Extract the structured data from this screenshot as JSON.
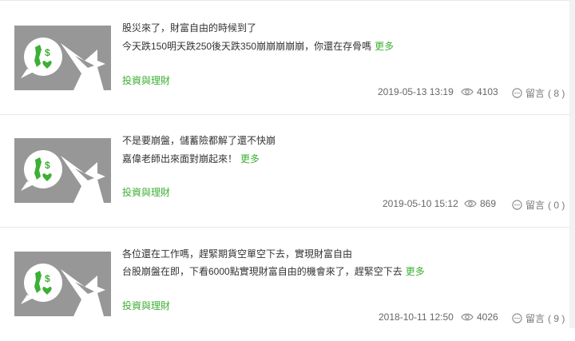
{
  "posts": [
    {
      "title": "股災來了，財富自由的時候到了",
      "excerpt": "今天跌150明天跌250後天跌350崩崩崩崩崩，你還在存骨嗎",
      "more_label": "更多",
      "category": "投資與理財",
      "date": "2019-05-13 13:19",
      "views": "4103",
      "comments_label": "留言",
      "comments_count": "( 8 )"
    },
    {
      "title": "不是要崩盤，儲蓄險都解了還不快崩",
      "excerpt": "嘉偉老師出來面對崩起來！",
      "more_label": "更多",
      "category": "投資與理財",
      "date": "2019-05-10 15:12",
      "views": "869",
      "comments_label": "留言",
      "comments_count": "( 0 )"
    },
    {
      "title": "各位還在工作嗎，趕緊期貨空單空下去，實現財富自由",
      "excerpt": "台股崩盤在即，下看6000點實現財富自由的機會來了，趕緊空下去",
      "more_label": "更多",
      "category": "投資與理財",
      "date": "2018-10-11 12:50",
      "views": "4026",
      "comments_label": "留言",
      "comments_count": "( 9 )"
    }
  ],
  "icons": {
    "thumbnail": "speech-bubble-taiwan-money-icon",
    "views": "eye-icon",
    "comments": "speech-dots-icon"
  },
  "colors": {
    "accent": "#3cb034",
    "thumb_bg": "#979797",
    "text": "#333333",
    "meta": "#666666"
  }
}
